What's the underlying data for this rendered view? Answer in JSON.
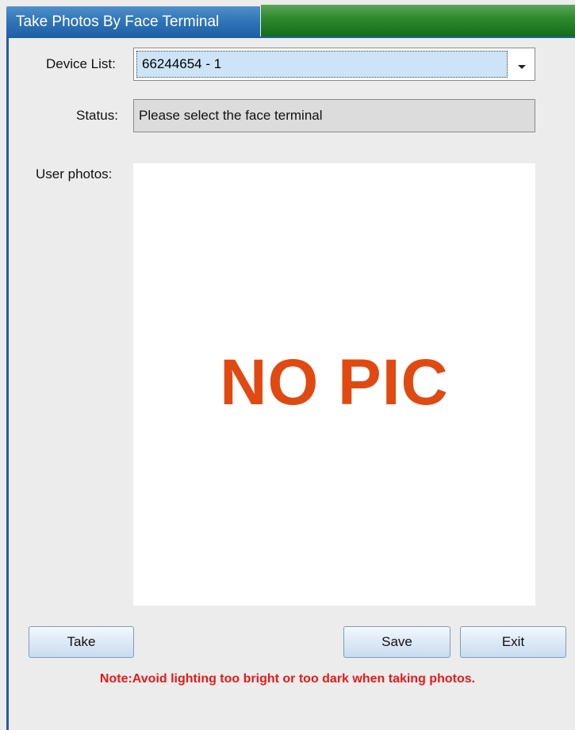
{
  "window": {
    "title": "Take Photos By Face Terminal"
  },
  "device_list": {
    "label": "Device List:",
    "selected": "66244654 - 1"
  },
  "status": {
    "label": "Status:",
    "value": "Please select the face terminal"
  },
  "photos": {
    "label": "User photos:",
    "placeholder_text": "NO PIC"
  },
  "buttons": {
    "take": "Take",
    "save": "Save",
    "exit": "Exit"
  },
  "note": "Note:Avoid lighting too bright or too dark when taking photos.",
  "colors": {
    "title_blue": "#2f73b7",
    "title_green": "#2f8a2f",
    "nopic": "#e04a12",
    "note_red": "#e41b1b"
  }
}
